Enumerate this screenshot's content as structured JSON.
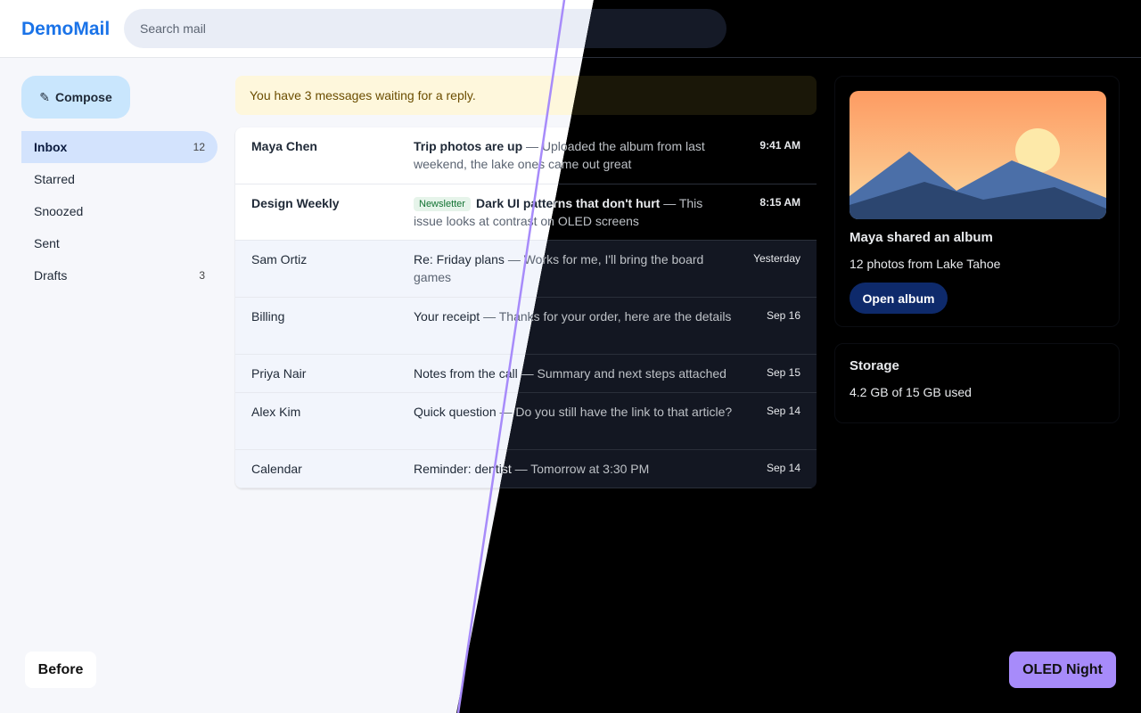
{
  "app": {
    "logo": "DemoMail"
  },
  "search": {
    "placeholder": "Search mail"
  },
  "compose": {
    "icon": "pencil-icon",
    "label": "Compose"
  },
  "nav": [
    {
      "label": "Inbox",
      "count": "12",
      "active": true
    },
    {
      "label": "Starred",
      "count": ""
    },
    {
      "label": "Snoozed",
      "count": ""
    },
    {
      "label": "Sent",
      "count": ""
    },
    {
      "label": "Drafts",
      "count": "3"
    }
  ],
  "banner": {
    "text": "You have 3 messages waiting for a reply."
  },
  "messages": [
    {
      "sender": "Maya Chen",
      "subject": "Trip photos are up",
      "sep": " — ",
      "snippet": "Uploaded the album from last weekend, the lake ones came out great",
      "time": "9:41 AM",
      "unread": true,
      "badge": ""
    },
    {
      "sender": "Design Weekly",
      "subject": "Dark UI patterns that don't hurt",
      "sep": " — ",
      "snippet": "This issue looks at contrast on OLED screens",
      "time": "8:15 AM",
      "unread": true,
      "badge": "Newsletter"
    },
    {
      "sender": "Sam Ortiz",
      "subject": "Re: Friday plans",
      "sep": " — ",
      "snippet": "Works for me, I'll bring the board games",
      "time": "Yesterday",
      "unread": false,
      "badge": ""
    },
    {
      "sender": "Billing",
      "subject": "Your receipt",
      "sep": " — ",
      "snippet": "Thanks for your order, here are the details",
      "time": "Sep 16",
      "unread": false,
      "badge": ""
    },
    {
      "sender": "Priya Nair",
      "subject": "Notes from the call",
      "sep": " — ",
      "snippet": "Summary and next steps attached",
      "time": "Sep 15",
      "unread": false,
      "badge": ""
    },
    {
      "sender": "Alex Kim",
      "subject": "Quick question",
      "sep": " — ",
      "snippet": "Do you still have the link to that article?",
      "time": "Sep 14",
      "unread": false,
      "badge": ""
    },
    {
      "sender": "Calendar",
      "subject": "Reminder: dentist",
      "sep": " — ",
      "snippet": "Tomorrow at 3:30 PM",
      "time": "Sep 14",
      "unread": false,
      "badge": ""
    }
  ],
  "album_card": {
    "title": "Maya shared an album",
    "subtitle": "12 photos from Lake Tahoe",
    "button": "Open album",
    "art": "mountain-sunset-illustration"
  },
  "storage_card": {
    "title": "Storage",
    "usage": "4.2 GB of 15 GB used"
  },
  "compare": {
    "before_label": "Before",
    "after_label": "OLED Night",
    "divider_color": "#a78bfa"
  }
}
